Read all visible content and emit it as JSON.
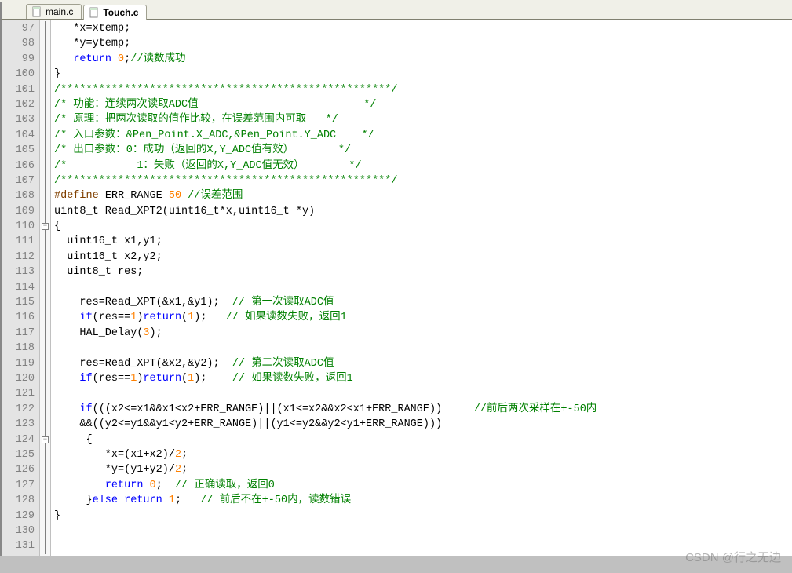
{
  "tabs": [
    {
      "label": "main.c",
      "active": false
    },
    {
      "label": "Touch.c",
      "active": true
    }
  ],
  "first_line": 97,
  "code_lines": [
    [
      [
        "txt",
        "   *x=xtemp;"
      ]
    ],
    [
      [
        "txt",
        "   *y=ytemp;"
      ]
    ],
    [
      [
        "txt",
        "   "
      ],
      [
        "kw",
        "return"
      ],
      [
        "txt",
        " "
      ],
      [
        "num",
        "0"
      ],
      [
        "txt",
        ";"
      ],
      [
        "cm",
        "//读数成功"
      ]
    ],
    [
      [
        "txt",
        "}"
      ]
    ],
    [
      [
        "cm",
        "/****************************************************/"
      ]
    ],
    [
      [
        "cm",
        "/* 功能：连续两次读取ADC值                          */"
      ]
    ],
    [
      [
        "cm",
        "/* 原理：把两次读取的值作比较，在误差范围内可取   */"
      ]
    ],
    [
      [
        "cm",
        "/* 入口参数：&Pen_Point.X_ADC,&Pen_Point.Y_ADC    */"
      ]
    ],
    [
      [
        "cm",
        "/* 出口参数：0：成功（返回的X,Y_ADC值有效）       */"
      ]
    ],
    [
      [
        "cm",
        "/*           1：失败（返回的X,Y_ADC值无效）       */"
      ]
    ],
    [
      [
        "cm",
        "/****************************************************/"
      ]
    ],
    [
      [
        "pp",
        "#define"
      ],
      [
        "txt",
        " ERR_RANGE "
      ],
      [
        "num",
        "50"
      ],
      [
        "txt",
        " "
      ],
      [
        "cm",
        "//误差范围"
      ]
    ],
    [
      [
        "txt",
        "uint8_t Read_XPT2(uint16_t*x,uint16_t *y)"
      ]
    ],
    [
      [
        "txt",
        "{"
      ]
    ],
    [
      [
        "txt",
        "  uint16_t x1,y1;"
      ]
    ],
    [
      [
        "txt",
        "  uint16_t x2,y2;"
      ]
    ],
    [
      [
        "txt",
        "  uint8_t res;"
      ]
    ],
    [
      [
        "txt",
        ""
      ]
    ],
    [
      [
        "txt",
        "    res=Read_XPT(&x1,&y1);  "
      ],
      [
        "cm",
        "// 第一次读取ADC值"
      ]
    ],
    [
      [
        "txt",
        "    "
      ],
      [
        "kw",
        "if"
      ],
      [
        "txt",
        "(res=="
      ],
      [
        "num",
        "1"
      ],
      [
        "txt",
        ")"
      ],
      [
        "kw",
        "return"
      ],
      [
        "txt",
        "("
      ],
      [
        "num",
        "1"
      ],
      [
        "txt",
        ");   "
      ],
      [
        "cm",
        "// 如果读数失败，返回1"
      ]
    ],
    [
      [
        "txt",
        "    HAL_Delay("
      ],
      [
        "num",
        "3"
      ],
      [
        "txt",
        ");"
      ]
    ],
    [
      [
        "txt",
        ""
      ]
    ],
    [
      [
        "txt",
        "    res=Read_XPT(&x2,&y2);  "
      ],
      [
        "cm",
        "// 第二次读取ADC值"
      ]
    ],
    [
      [
        "txt",
        "    "
      ],
      [
        "kw",
        "if"
      ],
      [
        "txt",
        "(res=="
      ],
      [
        "num",
        "1"
      ],
      [
        "txt",
        ")"
      ],
      [
        "kw",
        "return"
      ],
      [
        "txt",
        "("
      ],
      [
        "num",
        "1"
      ],
      [
        "txt",
        ");    "
      ],
      [
        "cm",
        "// 如果读数失败，返回1"
      ]
    ],
    [
      [
        "txt",
        ""
      ]
    ],
    [
      [
        "txt",
        "    "
      ],
      [
        "kw",
        "if"
      ],
      [
        "txt",
        "(((x2<=x1&&x1<x2+ERR_RANGE)||(x1<=x2&&x2<x1+ERR_RANGE))     "
      ],
      [
        "cm",
        "//前后两次采样在+-50内"
      ]
    ],
    [
      [
        "txt",
        "    &&((y2<=y1&&y1<y2+ERR_RANGE)||(y1<=y2&&y2<y1+ERR_RANGE)))"
      ]
    ],
    [
      [
        "txt",
        "     {"
      ]
    ],
    [
      [
        "txt",
        "        *x=(x1+x2)/"
      ],
      [
        "num",
        "2"
      ],
      [
        "txt",
        ";"
      ]
    ],
    [
      [
        "txt",
        "        *y=(y1+y2)/"
      ],
      [
        "num",
        "2"
      ],
      [
        "txt",
        ";"
      ]
    ],
    [
      [
        "txt",
        "        "
      ],
      [
        "kw",
        "return"
      ],
      [
        "txt",
        " "
      ],
      [
        "num",
        "0"
      ],
      [
        "txt",
        ";  "
      ],
      [
        "cm",
        "// 正确读取，返回0"
      ]
    ],
    [
      [
        "txt",
        "     }"
      ],
      [
        "kw",
        "else"
      ],
      [
        "txt",
        " "
      ],
      [
        "kw",
        "return"
      ],
      [
        "txt",
        " "
      ],
      [
        "num",
        "1"
      ],
      [
        "txt",
        ";   "
      ],
      [
        "cm",
        "// 前后不在+-50内，读数错误"
      ]
    ],
    [
      [
        "txt",
        "}"
      ]
    ],
    [
      [
        "txt",
        ""
      ]
    ],
    [
      [
        "txt",
        ""
      ]
    ]
  ],
  "watermark": "CSDN @行之无边",
  "fold_markers": {
    "110": "minus",
    "124": "minus"
  }
}
